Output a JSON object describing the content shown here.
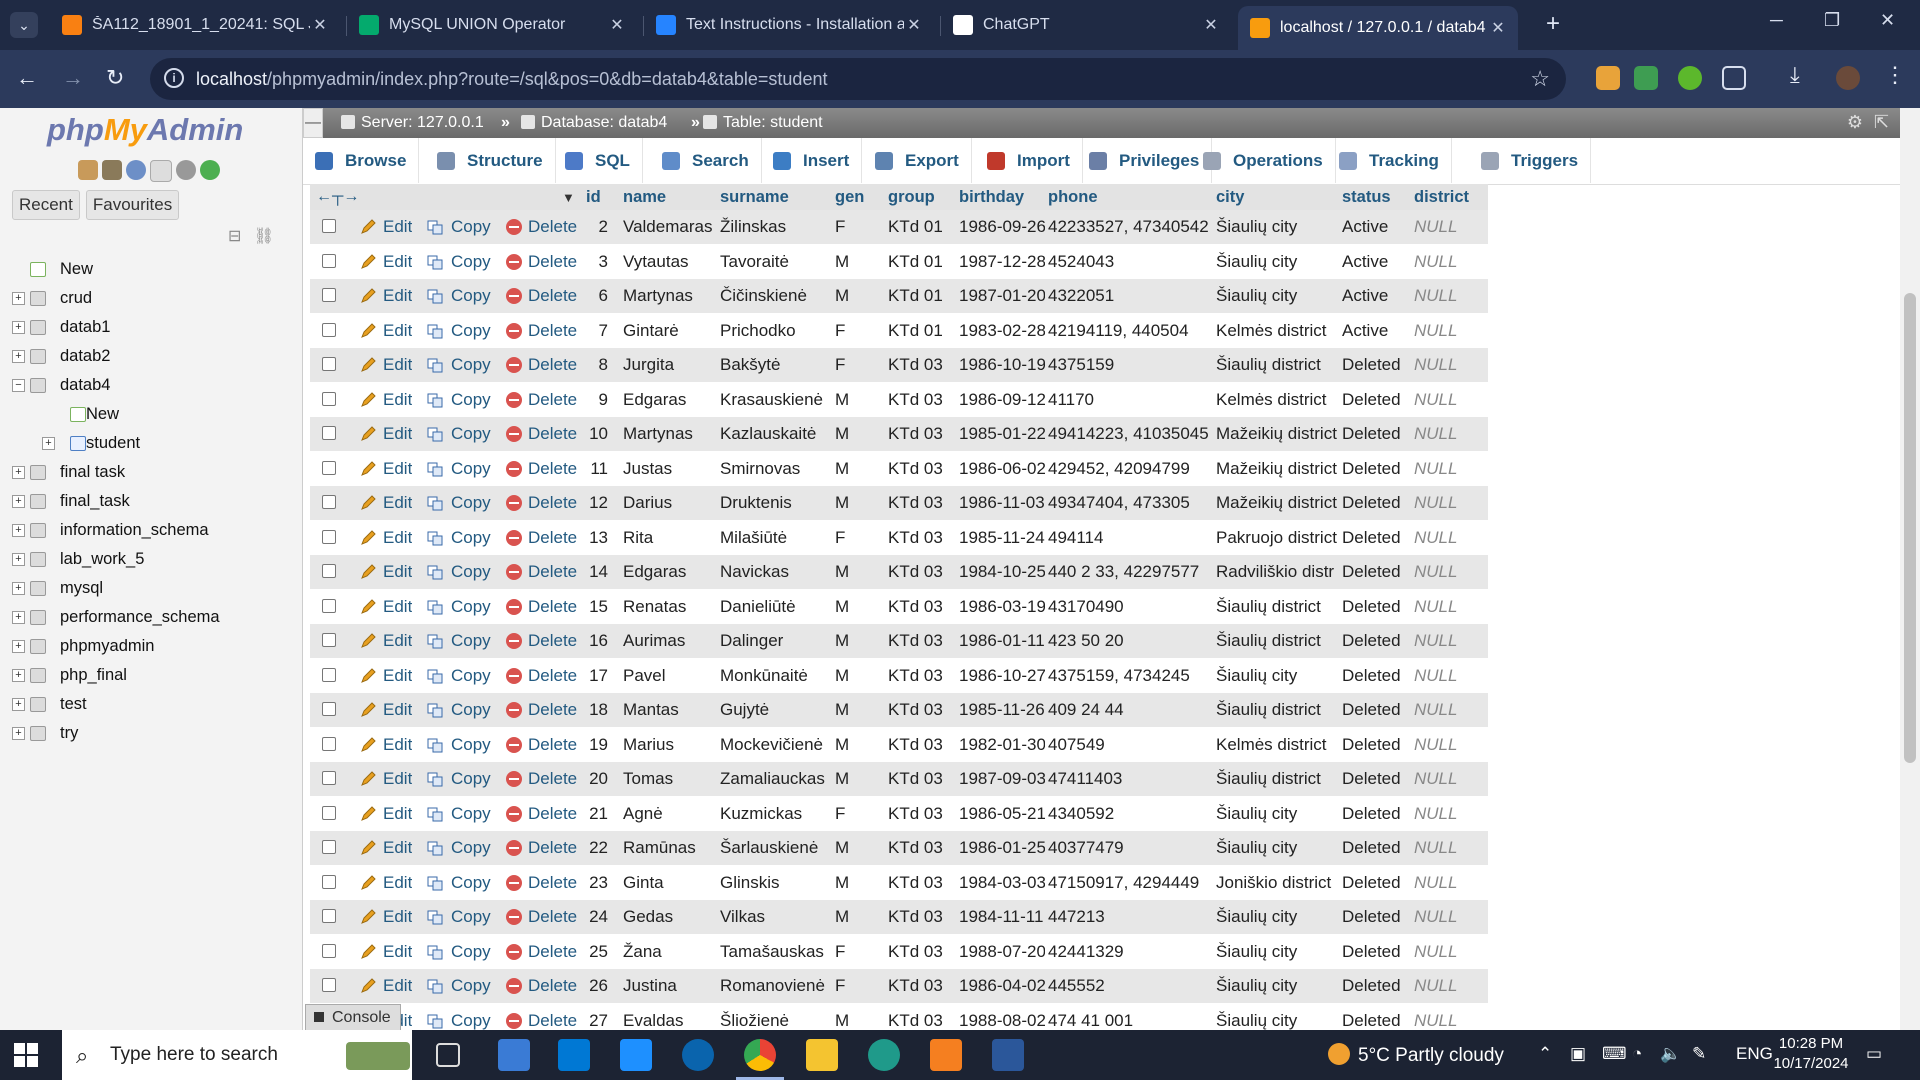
{
  "browser": {
    "tabs": [
      {
        "title": "ŠA112_18901_1_20241: SQL JOI",
        "favicon": "moodle-icon",
        "color": "#f98012"
      },
      {
        "title": "MySQL UNION Operator",
        "favicon": "w3schools-icon",
        "color": "#04aa6d"
      },
      {
        "title": "Text Instructions - Installation a",
        "favicon": "confluence-icon",
        "color": "#2684ff"
      },
      {
        "title": "ChatGPT",
        "favicon": "chatgpt-icon",
        "color": "#ffffff"
      },
      {
        "title": "localhost / 127.0.0.1 / datab4 / ",
        "favicon": "phpmyadmin-icon",
        "color": "#f89c0e"
      }
    ],
    "url_host": "localhost",
    "url_path": "/phpmyadmin/index.php?route=/sql&pos=0&db=datab4&table=student"
  },
  "pma": {
    "logo": {
      "php": "php",
      "my": "My",
      "admin": "Admin"
    },
    "nav_tabs": [
      "Recent",
      "Favourites"
    ],
    "tree": [
      {
        "label": "New",
        "type": "new",
        "expandable": false
      },
      {
        "label": "crud",
        "type": "db",
        "expandable": true
      },
      {
        "label": "datab1",
        "type": "db",
        "expandable": true
      },
      {
        "label": "datab2",
        "type": "db",
        "expandable": true
      },
      {
        "label": "datab4",
        "type": "db",
        "expandable": true,
        "expanded": true
      },
      {
        "label": "New",
        "type": "new",
        "child": true
      },
      {
        "label": "student",
        "type": "table",
        "child": true,
        "expandable": true
      },
      {
        "label": "final task",
        "type": "db",
        "expandable": true
      },
      {
        "label": "final_task",
        "type": "db",
        "expandable": true
      },
      {
        "label": "information_schema",
        "type": "db",
        "expandable": true
      },
      {
        "label": "lab_work_5",
        "type": "db",
        "expandable": true
      },
      {
        "label": "mysql",
        "type": "db",
        "expandable": true
      },
      {
        "label": "performance_schema",
        "type": "db",
        "expandable": true
      },
      {
        "label": "phpmyadmin",
        "type": "db",
        "expandable": true
      },
      {
        "label": "php_final",
        "type": "db",
        "expandable": true
      },
      {
        "label": "test",
        "type": "db",
        "expandable": true
      },
      {
        "label": "try",
        "type": "db",
        "expandable": true
      }
    ],
    "breadcrumb": {
      "server": "Server: 127.0.0.1",
      "database": "Database: datab4",
      "table": "Table: student"
    },
    "menu_tabs": [
      "Browse",
      "Structure",
      "SQL",
      "Search",
      "Insert",
      "Export",
      "Import",
      "Privileges",
      "Operations",
      "Tracking",
      "Triggers"
    ],
    "columns": [
      "id",
      "name",
      "surname",
      "gen",
      "group",
      "birthday",
      "phone",
      "city",
      "status",
      "district"
    ],
    "actions": {
      "edit": "Edit",
      "copy": "Copy",
      "delete": "Delete"
    },
    "rows": [
      [
        "2",
        "Valdemaras",
        "Žilinskas",
        "F",
        "KTd 01",
        "1986-09-26",
        "42233527, 47340542",
        "Šiaulių city",
        "Active",
        "NULL"
      ],
      [
        "3",
        "Vytautas",
        "Tavoraitė",
        "M",
        "KTd 01",
        "1987-12-28",
        "4524043",
        "Šiaulių city",
        "Active",
        "NULL"
      ],
      [
        "6",
        "Martynas",
        "Čičinskienė",
        "M",
        "KTd 01",
        "1987-01-20",
        "4322051",
        "Šiaulių city",
        "Active",
        "NULL"
      ],
      [
        "7",
        "Gintarė",
        "Prichodko",
        "F",
        "KTd 01",
        "1983-02-28",
        "42194119, 440504",
        "Kelmės district",
        "Active",
        "NULL"
      ],
      [
        "8",
        "Jurgita",
        "Bakšytė",
        "F",
        "KTd 03",
        "1986-10-19",
        "4375159",
        "Šiaulių district",
        "Deleted",
        "NULL"
      ],
      [
        "9",
        "Edgaras",
        "Krasauskienė",
        "M",
        "KTd 03",
        "1986-09-12",
        "41170",
        "Kelmės district",
        "Deleted",
        "NULL"
      ],
      [
        "10",
        "Martynas",
        "Kazlauskaitė",
        "M",
        "KTd 03",
        "1985-01-22",
        "49414223, 41035045",
        "Mažeikių district",
        "Deleted",
        "NULL"
      ],
      [
        "11",
        "Justas",
        "Smirnovas",
        "M",
        "KTd 03",
        "1986-06-02",
        "429452, 42094799",
        "Mažeikių district",
        "Deleted",
        "NULL"
      ],
      [
        "12",
        "Darius",
        "Druktenis",
        "M",
        "KTd 03",
        "1986-11-03",
        "49347404, 473305",
        "Mažeikių district",
        "Deleted",
        "NULL"
      ],
      [
        "13",
        "Rita",
        "Milašiūtė",
        "F",
        "KTd 03",
        "1985-11-24",
        "494114",
        "Pakruojo district",
        "Deleted",
        "NULL"
      ],
      [
        "14",
        "Edgaras",
        "Navickas",
        "M",
        "KTd 03",
        "1984-10-25",
        "440 2 33, 42297577",
        "Radviliškio distr",
        "Deleted",
        "NULL"
      ],
      [
        "15",
        "Renatas",
        "Danieliūtė",
        "M",
        "KTd 03",
        "1986-03-19",
        "43170490",
        "Šiaulių district",
        "Deleted",
        "NULL"
      ],
      [
        "16",
        "Aurimas",
        "Dalinger",
        "M",
        "KTd 03",
        "1986-01-11",
        "423 50 20",
        "Šiaulių district",
        "Deleted",
        "NULL"
      ],
      [
        "17",
        "Pavel",
        "Monkūnaitė",
        "M",
        "KTd 03",
        "1986-10-27",
        "4375159, 4734245",
        "Šiaulių city",
        "Deleted",
        "NULL"
      ],
      [
        "18",
        "Mantas",
        "Gujytė",
        "M",
        "KTd 03",
        "1985-11-26",
        "409 24 44",
        "Šiaulių district",
        "Deleted",
        "NULL"
      ],
      [
        "19",
        "Marius",
        "Mockevičienė",
        "M",
        "KTd 03",
        "1982-01-30",
        "407549",
        "Kelmės district",
        "Deleted",
        "NULL"
      ],
      [
        "20",
        "Tomas",
        "Zamaliauckas",
        "M",
        "KTd 03",
        "1987-09-03",
        "47411403",
        "Šiaulių district",
        "Deleted",
        "NULL"
      ],
      [
        "21",
        "Agnė",
        "Kuzmickas",
        "F",
        "KTd 03",
        "1986-05-21",
        "4340592",
        "Šiaulių city",
        "Deleted",
        "NULL"
      ],
      [
        "22",
        "Ramūnas",
        "Šarlauskienė",
        "M",
        "KTd 03",
        "1986-01-25",
        "40377479",
        "Šiaulių city",
        "Deleted",
        "NULL"
      ],
      [
        "23",
        "Ginta",
        "Glinskis",
        "M",
        "KTd 03",
        "1984-03-03",
        "47150917, 4294449",
        "Joniškio district",
        "Deleted",
        "NULL"
      ],
      [
        "24",
        "Gedas",
        "Vilkas",
        "M",
        "KTd 03",
        "1984-11-11",
        "447213",
        "Šiaulių city",
        "Deleted",
        "NULL"
      ],
      [
        "25",
        "Žana",
        "Tamašauskas",
        "F",
        "KTd 03",
        "1988-07-20",
        "42441329",
        "Šiaulių city",
        "Deleted",
        "NULL"
      ],
      [
        "26",
        "Justina",
        "Romanovienė",
        "F",
        "KTd 03",
        "1986-04-02",
        "445552",
        "Šiaulių city",
        "Deleted",
        "NULL"
      ],
      [
        "27",
        "Evaldas",
        "Šliožienė",
        "M",
        "KTd 03",
        "1988-08-02",
        "474 41 001",
        "Šiaulių city",
        "Deleted",
        "NULL"
      ]
    ],
    "console": "Console"
  },
  "taskbar": {
    "search_placeholder": "Type here to search",
    "weather": "5°C  Partly cloudy",
    "lang": "ENG",
    "time": "10:28 PM",
    "date": "10/17/2024"
  }
}
